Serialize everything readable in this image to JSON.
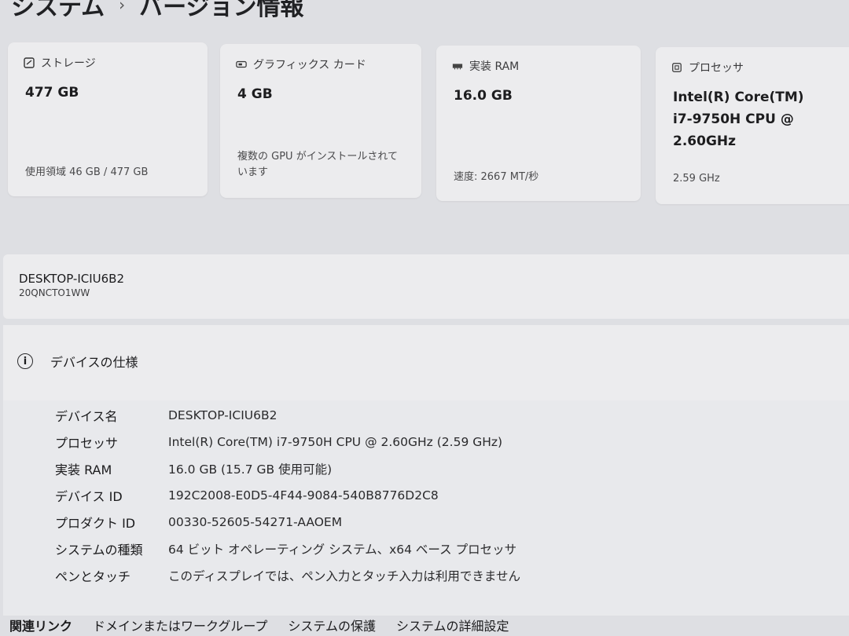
{
  "breadcrumb": {
    "parent": "システム",
    "separator": "›",
    "current": "バージョン情報"
  },
  "cards": [
    {
      "icon": "storage-icon",
      "label": "ストレージ",
      "value": "477 GB",
      "footer": "使用領域 46 GB / 477 GB"
    },
    {
      "icon": "graphics-card-icon",
      "label": "グラフィックス カード",
      "value": "4 GB",
      "footer": "複数の GPU がインストールされています"
    },
    {
      "icon": "memory-icon",
      "label": "実装 RAM",
      "value": "16.0 GB",
      "footer": "速度: 2667 MT/秒"
    },
    {
      "icon": "processor-icon",
      "label": "プロセッサ",
      "value": "Intel(R) Core(TM) i7-9750H CPU @ 2.60GHz",
      "footer": "2.59 GHz"
    }
  ],
  "device": {
    "hostname": "DESKTOP-ICIU6B2",
    "model": "20QNCTO1WW"
  },
  "specs": {
    "title": "デバイスの仕様",
    "rows": [
      {
        "key": "デバイス名",
        "value": "DESKTOP-ICIU6B2"
      },
      {
        "key": "プロセッサ",
        "value": "Intel(R) Core(TM) i7-9750H CPU @ 2.60GHz (2.59 GHz)"
      },
      {
        "key": "実装 RAM",
        "value": "16.0 GB (15.7 GB 使用可能)"
      },
      {
        "key": "デバイス ID",
        "value": "192C2008-E0D5-4F44-9084-540B8776D2C8"
      },
      {
        "key": "プロダクト ID",
        "value": "00330-52605-54271-AAOEM"
      },
      {
        "key": "システムの種類",
        "value": "64 ビット オペレーティング システム、x64 ベース プロセッサ"
      },
      {
        "key": "ペンとタッチ",
        "value": "このディスプレイでは、ペン入力とタッチ入力は利用できません"
      }
    ]
  },
  "related_links": {
    "title": "関連リンク",
    "items": [
      "ドメインまたはワークグループ",
      "システムの保護",
      "システムの詳細設定"
    ]
  }
}
